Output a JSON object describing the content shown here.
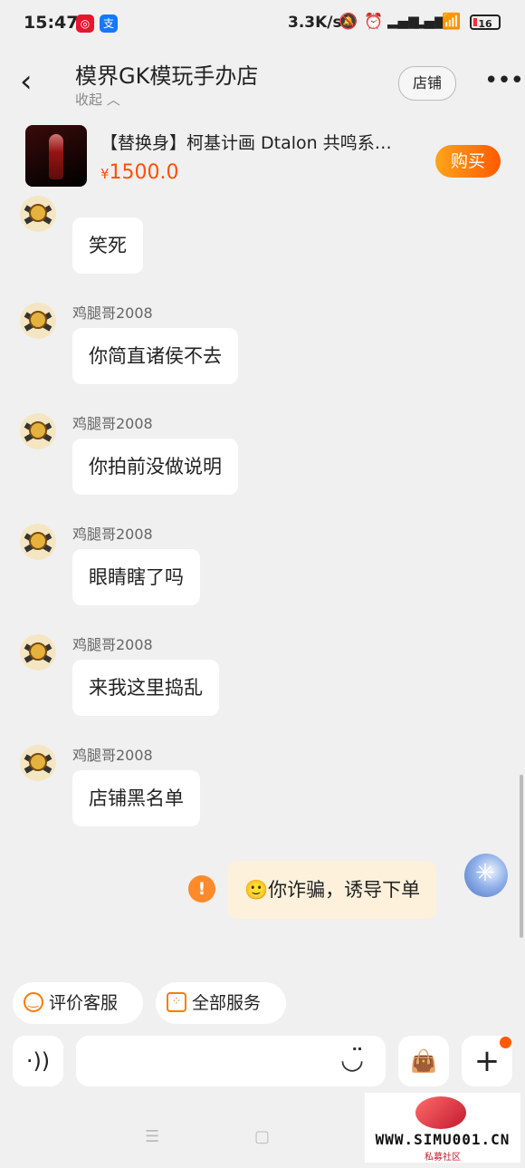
{
  "status_bar": {
    "time": "15:47",
    "app_icons": [
      "weibo-icon",
      "alipay-icon"
    ],
    "network_speed": "3.3K/s",
    "battery": "16"
  },
  "header": {
    "title": "模界GK模玩手办店",
    "collapse_label": "收起",
    "shop_button": "店铺",
    "more_label": "•••"
  },
  "product": {
    "title": "【替换身】柯基计画 Dtalon 共鸣系…",
    "currency": "¥",
    "price": "1500.0",
    "buy_label": "购买"
  },
  "messages": [
    {
      "sender": "",
      "text": "笑死"
    },
    {
      "sender": "鸡腿哥2008",
      "text": "你简直诸侯不去"
    },
    {
      "sender": "鸡腿哥2008",
      "text": "你拍前没做说明"
    },
    {
      "sender": "鸡腿哥2008",
      "text": "眼睛瞎了吗"
    },
    {
      "sender": "鸡腿哥2008",
      "text": "来我这里捣乱"
    },
    {
      "sender": "鸡腿哥2008",
      "text": "店铺黑名单"
    }
  ],
  "outgoing": {
    "text": "你诈骗，诱导下单",
    "emoji": "🙂",
    "warning": "!"
  },
  "quick_actions": {
    "rate": "评价客服",
    "services": "全部服务"
  },
  "watermark": {
    "text": "WWW.SIMU001.CN",
    "sub": "私募社区"
  },
  "colors": {
    "accent": "#ff5000",
    "bubble_out": "#fdf1dc",
    "background": "#f0f0f0"
  }
}
